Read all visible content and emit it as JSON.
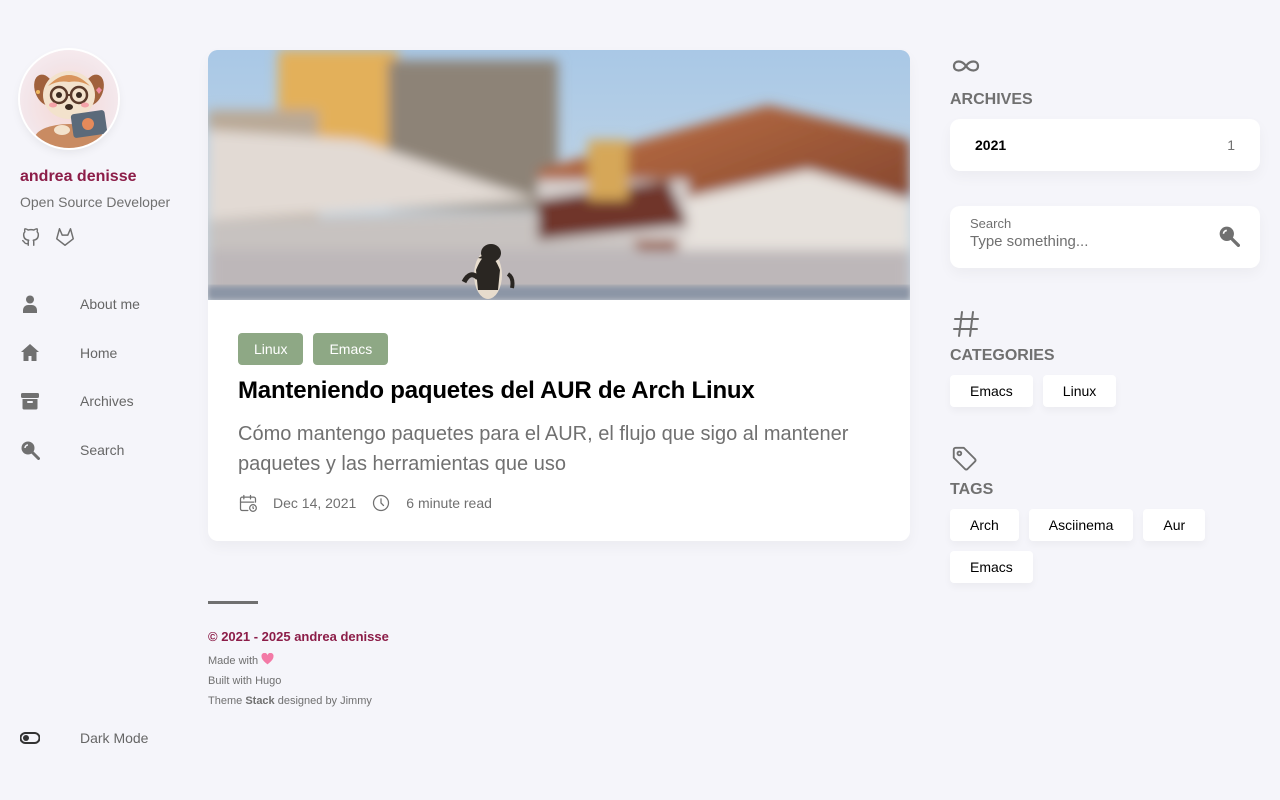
{
  "profile": {
    "name": "andrea denisse",
    "description": "Open Source Developer",
    "socials": [
      "github-icon",
      "gitlab-icon"
    ]
  },
  "menu": [
    {
      "label": "About me",
      "icon": "user-icon"
    },
    {
      "label": "Home",
      "icon": "home-icon"
    },
    {
      "label": "Archives",
      "icon": "archive-box-icon"
    },
    {
      "label": "Search",
      "icon": "search-icon"
    }
  ],
  "dark_mode": {
    "label": "Dark Mode",
    "icon": "toggle-icon"
  },
  "article": {
    "categories": [
      "Linux",
      "Emacs"
    ],
    "title": "Manteniendo paquetes del AUR de Arch Linux",
    "subtitle": "Cómo mantengo paquetes para el AUR, el flujo que sigo al mantener paquetes y las herramientas que uso",
    "date": "Dec 14, 2021",
    "read_time": "6 minute read"
  },
  "footer": {
    "copyright": "© 2021 - 2025 andrea denisse",
    "made_with": "Made with",
    "built_with": "Built with Hugo",
    "theme_prefix": "Theme",
    "theme_name": "Stack",
    "theme_suffix": "designed by Jimmy"
  },
  "sidebar_right": {
    "archives": {
      "title": "Archives",
      "items": [
        {
          "year": "2021",
          "count": "1"
        }
      ]
    },
    "search": {
      "label": "Search",
      "placeholder": "Type something..."
    },
    "categories": {
      "title": "Categories",
      "items": [
        "Emacs",
        "Linux"
      ]
    },
    "tags": {
      "title": "Tags",
      "items": [
        "Arch",
        "Asciinema",
        "Aur",
        "Emacs"
      ]
    }
  },
  "colors": {
    "accent": "#8c1d48",
    "tag_background": "#8ea885",
    "page_background": "#f5f5fa"
  }
}
